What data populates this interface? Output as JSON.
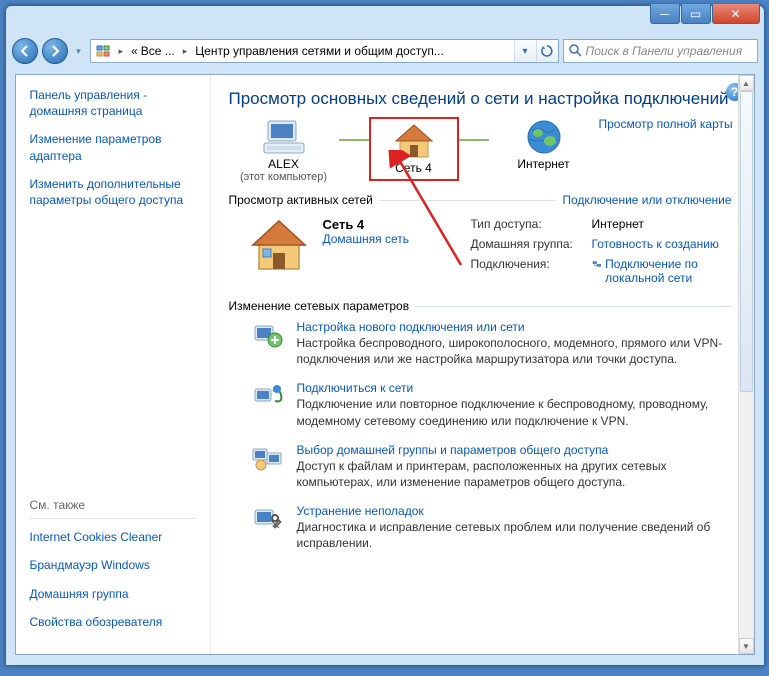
{
  "breadcrumb": {
    "seg1": "Все ...",
    "seg2": "Центр управления сетями и общим доступ..."
  },
  "search": {
    "placeholder": "Поиск в Панели управления"
  },
  "sidebar": {
    "links": [
      "Панель управления - домашняя страница",
      "Изменение параметров адаптера",
      "Изменить дополнительные параметры общего доступа"
    ],
    "seealso_title": "См. также",
    "seealso": [
      "Internet Cookies Cleaner",
      "Брандмауэр Windows",
      "Домашняя группа",
      "Свойства обозревателя"
    ]
  },
  "content": {
    "title": "Просмотр основных сведений о сети и настройка подключений",
    "map": {
      "pc": "ALEX",
      "pc_sub": "(этот компьютер)",
      "net": "Сеть  4",
      "inet": "Интернет",
      "fullmap": "Просмотр полной карты"
    },
    "active_header": "Просмотр активных сетей",
    "active_link": "Подключение или отключение",
    "network": {
      "name": "Сеть  4",
      "type": "Домашняя сеть"
    },
    "props": {
      "k1": "Тип доступа:",
      "v1": "Интернет",
      "k2": "Домашняя группа:",
      "v2": "Готовность к созданию",
      "k3": "Подключения:",
      "v3": "Подключение по локальной сети"
    },
    "change_header": "Изменение сетевых параметров",
    "opts": [
      {
        "title": "Настройка нового подключения или сети",
        "desc": "Настройка беспроводного, широкополосного, модемного, прямого или VPN-подключения или же настройка маршрутизатора или точки доступа."
      },
      {
        "title": "Подключиться к сети",
        "desc": "Подключение или повторное подключение к беспроводному, проводному, модемному сетевому соединению или подключение к VPN."
      },
      {
        "title": "Выбор домашней группы и параметров общего доступа",
        "desc": "Доступ к файлам и принтерам, расположенных на других сетевых компьютерах, или изменение параметров общего доступа."
      },
      {
        "title": "Устранение неполадок",
        "desc": "Диагностика и исправление сетевых проблем или получение сведений об исправлении."
      }
    ]
  }
}
